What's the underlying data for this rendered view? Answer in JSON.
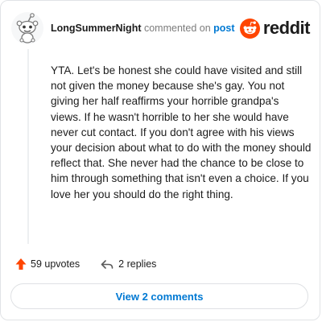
{
  "header": {
    "username": "LongSummerNight",
    "action_text": "commented on",
    "target_text": "post",
    "brand_name": "reddit",
    "avatar_icon": "snoo-avatar-icon",
    "brand_icon": "reddit-alien-icon"
  },
  "comment": {
    "body": "YTA. Let's be honest she could have visited and still not given the money because she's gay. You not giving her half reaffirms your horrible grandpa's views. If he wasn't horrible to her she would have never cut contact. If you don't agree with his views your decision about what to do with the money should reflect that. She never had the chance to be close to him through something that isn't even a choice. If you love her you should do the right thing."
  },
  "actions": {
    "upvotes_label": "59 upvotes",
    "replies_label": "2 replies",
    "upvote_icon": "upvote-arrow-icon",
    "reply_icon": "reply-arrow-icon"
  },
  "footer": {
    "view_comments_label": "View 2 comments"
  },
  "colors": {
    "brand_orange": "#ff4500",
    "link_blue": "#0079d3",
    "text": "#1c1c1c",
    "muted": "#7c7c7c",
    "border": "#e1e3e6"
  }
}
